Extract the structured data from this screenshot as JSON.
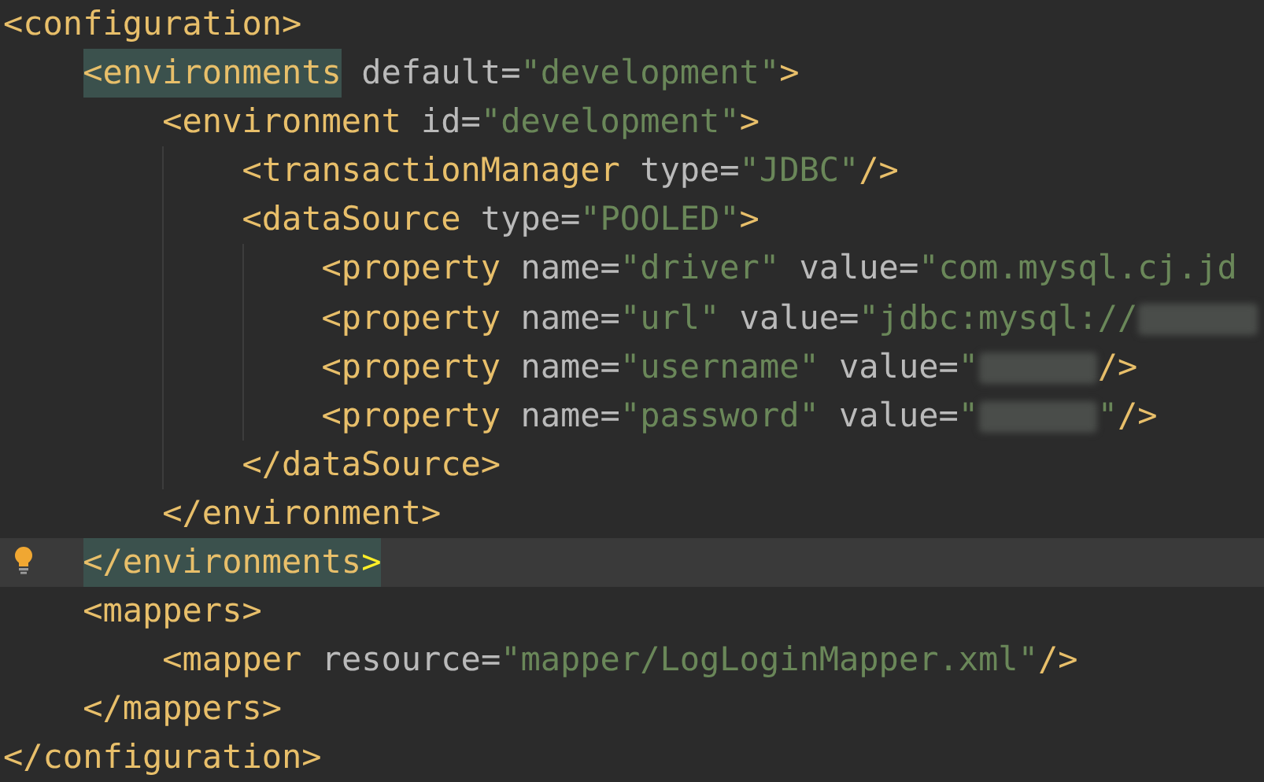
{
  "document": {
    "open": {
      "current": false,
      "hint": false,
      "tokens": [
        {
          "kind": "tag",
          "text": "<configuration>",
          "highlighted": false
        }
      ]
    },
    "close": {
      "current": false,
      "hint": false,
      "tokens": [
        {
          "kind": "tag",
          "text": "</configuration>",
          "highlighted": false
        }
      ]
    },
    "children": [
      {
        "open": {
          "current": false,
          "hint": false,
          "tokens": [
            {
              "kind": "tag",
              "text": "<environments",
              "highlighted": true
            },
            {
              "kind": "attr",
              "text": "default=",
              "highlighted": false
            },
            {
              "kind": "value",
              "text": "\"development\"",
              "highlighted": false
            },
            {
              "kind": "tag",
              "text": ">",
              "highlighted": false
            }
          ]
        },
        "close": {
          "current": true,
          "hint": true,
          "tokens": [
            {
              "kind": "tag",
              "text": "</environments",
              "highlighted": true
            },
            {
              "kind": "match",
              "text": ">",
              "highlighted": true
            }
          ]
        },
        "children": [
          {
            "open": {
              "current": false,
              "hint": false,
              "tokens": [
                {
                  "kind": "tag",
                  "text": "<environment",
                  "highlighted": false
                },
                {
                  "kind": "attr",
                  "text": "id=",
                  "highlighted": false
                },
                {
                  "kind": "value",
                  "text": "\"development\"",
                  "highlighted": false
                },
                {
                  "kind": "tag",
                  "text": ">",
                  "highlighted": false
                }
              ]
            },
            "close": {
              "current": false,
              "hint": false,
              "tokens": [
                {
                  "kind": "tag",
                  "text": "</environment>",
                  "highlighted": false
                }
              ]
            },
            "children": [
              {
                "open": {
                  "current": false,
                  "hint": false,
                  "tokens": [
                    {
                      "kind": "tag",
                      "text": "<transactionManager",
                      "highlighted": false
                    },
                    {
                      "kind": "attr",
                      "text": "type=",
                      "highlighted": false
                    },
                    {
                      "kind": "value",
                      "text": "\"JDBC\"",
                      "highlighted": false
                    },
                    {
                      "kind": "tag",
                      "text": "/>",
                      "highlighted": false
                    }
                  ]
                }
              },
              {
                "open": {
                  "current": false,
                  "hint": false,
                  "tokens": [
                    {
                      "kind": "tag",
                      "text": "<dataSource",
                      "highlighted": false
                    },
                    {
                      "kind": "attr",
                      "text": "type=",
                      "highlighted": false
                    },
                    {
                      "kind": "value",
                      "text": "\"POOLED\"",
                      "highlighted": false
                    },
                    {
                      "kind": "tag",
                      "text": ">",
                      "highlighted": false
                    }
                  ]
                },
                "close": {
                  "current": false,
                  "hint": false,
                  "tokens": [
                    {
                      "kind": "tag",
                      "text": "</dataSource>",
                      "highlighted": false
                    }
                  ]
                },
                "children": [
                  {
                    "open": {
                      "current": false,
                      "hint": false,
                      "tokens": [
                        {
                          "kind": "tag",
                          "text": "<property",
                          "highlighted": false
                        },
                        {
                          "kind": "attr",
                          "text": "name=",
                          "highlighted": false
                        },
                        {
                          "kind": "value",
                          "text": "\"driver\"",
                          "highlighted": false
                        },
                        {
                          "kind": "attr",
                          "text": "value=",
                          "highlighted": false
                        },
                        {
                          "kind": "value",
                          "text": "\"com.mysql.cj.jd",
                          "highlighted": false
                        }
                      ]
                    }
                  },
                  {
                    "open": {
                      "current": false,
                      "hint": false,
                      "tokens": [
                        {
                          "kind": "tag",
                          "text": "<property",
                          "highlighted": false
                        },
                        {
                          "kind": "attr",
                          "text": "name=",
                          "highlighted": false
                        },
                        {
                          "kind": "value",
                          "text": "\"url\"",
                          "highlighted": false
                        },
                        {
                          "kind": "attr",
                          "text": "value=",
                          "highlighted": false
                        },
                        {
                          "kind": "value",
                          "text": "\"jdbc:mysql://",
                          "highlighted": false
                        },
                        {
                          "kind": "redacted"
                        }
                      ]
                    }
                  },
                  {
                    "open": {
                      "current": false,
                      "hint": false,
                      "tokens": [
                        {
                          "kind": "tag",
                          "text": "<property",
                          "highlighted": false
                        },
                        {
                          "kind": "attr",
                          "text": "name=",
                          "highlighted": false
                        },
                        {
                          "kind": "value",
                          "text": "\"username\"",
                          "highlighted": false
                        },
                        {
                          "kind": "attr",
                          "text": "value=",
                          "highlighted": false
                        },
                        {
                          "kind": "value",
                          "text": "\"",
                          "highlighted": false
                        },
                        {
                          "kind": "redacted"
                        },
                        {
                          "kind": "tag",
                          "text": "/>",
                          "highlighted": false
                        }
                      ]
                    }
                  },
                  {
                    "open": {
                      "current": false,
                      "hint": false,
                      "tokens": [
                        {
                          "kind": "tag",
                          "text": "<property",
                          "highlighted": false
                        },
                        {
                          "kind": "attr",
                          "text": "name=",
                          "highlighted": false
                        },
                        {
                          "kind": "value",
                          "text": "\"password\"",
                          "highlighted": false
                        },
                        {
                          "kind": "attr",
                          "text": "value=",
                          "highlighted": false
                        },
                        {
                          "kind": "value",
                          "text": "\"",
                          "highlighted": false
                        },
                        {
                          "kind": "redacted"
                        },
                        {
                          "kind": "value",
                          "text": "\"",
                          "highlighted": false
                        },
                        {
                          "kind": "tag",
                          "text": "/>",
                          "highlighted": false
                        }
                      ]
                    }
                  }
                ]
              }
            ]
          }
        ]
      },
      {
        "open": {
          "current": false,
          "hint": false,
          "tokens": [
            {
              "kind": "tag",
              "text": "<mappers>",
              "highlighted": false
            }
          ]
        },
        "close": {
          "current": false,
          "hint": false,
          "tokens": [
            {
              "kind": "tag",
              "text": "</mappers>",
              "highlighted": false
            }
          ]
        },
        "children": [
          {
            "open": {
              "current": false,
              "hint": false,
              "tokens": [
                {
                  "kind": "tag",
                  "text": "<mapper",
                  "highlighted": false
                },
                {
                  "kind": "attr",
                  "text": "resource=",
                  "highlighted": false
                },
                {
                  "kind": "value",
                  "text": "\"mapper/LogLoginMapper.xml\"",
                  "highlighted": false
                },
                {
                  "kind": "tag",
                  "text": "/>",
                  "highlighted": false
                }
              ]
            }
          }
        ]
      }
    ]
  }
}
